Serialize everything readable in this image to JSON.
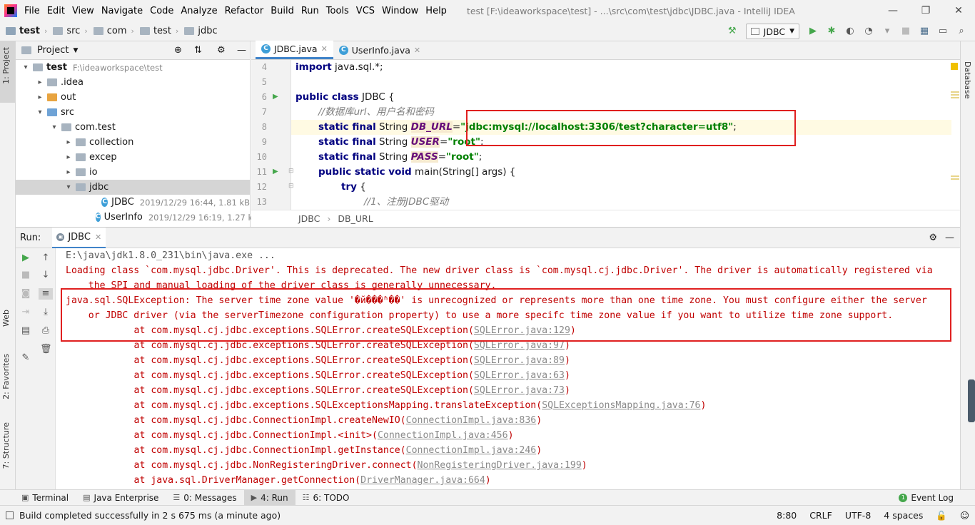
{
  "window": {
    "title": "test [F:\\ideaworkspace\\test] - ...\\src\\com\\test\\jdbc\\JDBC.java - IntelliJ IDEA",
    "menu": [
      "File",
      "Edit",
      "View",
      "Navigate",
      "Code",
      "Analyze",
      "Refactor",
      "Build",
      "Run",
      "Tools",
      "VCS",
      "Window",
      "Help"
    ]
  },
  "breadcrumb": [
    "test",
    "src",
    "com",
    "test",
    "jdbc"
  ],
  "toolbar": {
    "run_config": "JDBC"
  },
  "left_tool_tabs": [
    "1: Project",
    "Web",
    "2: Favorites",
    "7: Structure"
  ],
  "right_tool_tabs": [
    "Database"
  ],
  "project": {
    "header": "Project",
    "tree": [
      {
        "label": "test",
        "meta": "F:\\ideaworkspace\\test",
        "depth": 0,
        "arrow": "▾",
        "bold": true
      },
      {
        "label": ".idea",
        "meta": "",
        "depth": 1,
        "arrow": "▸"
      },
      {
        "label": "out",
        "meta": "",
        "depth": 1,
        "arrow": "▸"
      },
      {
        "label": "src",
        "meta": "",
        "depth": 1,
        "arrow": "▾"
      },
      {
        "label": "com.test",
        "meta": "",
        "depth": 2,
        "arrow": "▾"
      },
      {
        "label": "collection",
        "meta": "",
        "depth": 3,
        "arrow": "▸"
      },
      {
        "label": "excep",
        "meta": "",
        "depth": 3,
        "arrow": "▸"
      },
      {
        "label": "io",
        "meta": "",
        "depth": 3,
        "arrow": "▸"
      },
      {
        "label": "jdbc",
        "meta": "",
        "depth": 3,
        "arrow": "▾",
        "selected": true
      },
      {
        "label": "JDBC",
        "meta": "2019/12/29 16:44, 1.81 kB",
        "depth": 5,
        "arrow": "",
        "cls": true
      },
      {
        "label": "UserInfo",
        "meta": "2019/12/29 16:19, 1.27 kB",
        "depth": 5,
        "arrow": "",
        "cls": true
      }
    ]
  },
  "editor": {
    "tabs": [
      {
        "label": "JDBC.java",
        "active": true
      },
      {
        "label": "UserInfo.java",
        "active": false
      }
    ],
    "line_numbers": [
      "4",
      "5",
      "6",
      "7",
      "8",
      "9",
      "10",
      "11",
      "12",
      "13"
    ],
    "code": {
      "l4_kw": "import",
      "l4_rest": " java.sql.*;",
      "l6_kw": "public class",
      "l6_rest": " JDBC {",
      "l7_comment": "//数据库url、用户名和密码",
      "l8_kw": "static final",
      "l8_type": " String ",
      "l8_field": "DB_URL",
      "l8_eq": "=",
      "l8_str": "\"jdbc:mysql://localhost:3306/test?character=utf8\"",
      "l8_end": ";",
      "l9_kw": "static final",
      "l9_type": " String ",
      "l9_field": "USER",
      "l9_eq": "=",
      "l9_str": "\"root\"",
      "l9_end": ";",
      "l10_kw": "static final",
      "l10_type": " String ",
      "l10_field": "PASS",
      "l10_eq": "=",
      "l10_str": "\"root\"",
      "l10_end": ";",
      "l11_kw": "public static void",
      "l11_rest": " main(String[] args) {",
      "l12_kw": "try",
      "l12_rest": " {",
      "l13_comment": "//1、注册JDBC驱动"
    },
    "crumb": [
      "JDBC",
      "DB_URL"
    ]
  },
  "run": {
    "label": "Run:",
    "tab": "JDBC",
    "console": {
      "cmd": "E:\\java\\jdk1.8.0_231\\bin\\java.exe ...",
      "warn1": "Loading class `com.mysql.jdbc.Driver'. This is deprecated. The new driver class is `com.mysql.cj.jdbc.Driver'. The driver is automatically registered via",
      "warn2": "    the SPI and manual loading of the driver class is generally unnecessary.",
      "err1": "java.sql.SQLException: The server time zone value '�й���ʱ��' is unrecognized or represents more than one time zone. You must configure either the server",
      "err2": "    or JDBC driver (via the serverTimezone configuration property) to use a more specifc time zone value if you want to utilize time zone support.",
      "stack": [
        {
          "text": "\tat com.mysql.cj.jdbc.exceptions.SQLError.createSQLException(",
          "link": "SQLError.java:129"
        },
        {
          "text": "\tat com.mysql.cj.jdbc.exceptions.SQLError.createSQLException(",
          "link": "SQLError.java:97"
        },
        {
          "text": "\tat com.mysql.cj.jdbc.exceptions.SQLError.createSQLException(",
          "link": "SQLError.java:89"
        },
        {
          "text": "\tat com.mysql.cj.jdbc.exceptions.SQLError.createSQLException(",
          "link": "SQLError.java:63"
        },
        {
          "text": "\tat com.mysql.cj.jdbc.exceptions.SQLError.createSQLException(",
          "link": "SQLError.java:73"
        },
        {
          "text": "\tat com.mysql.cj.jdbc.exceptions.SQLExceptionsMapping.translateException(",
          "link": "SQLExceptionsMapping.java:76"
        },
        {
          "text": "\tat com.mysql.cj.jdbc.ConnectionImpl.createNewIO(",
          "link": "ConnectionImpl.java:836"
        },
        {
          "text": "\tat com.mysql.cj.jdbc.ConnectionImpl.<init>(",
          "link": "ConnectionImpl.java:456"
        },
        {
          "text": "\tat com.mysql.cj.jdbc.ConnectionImpl.getInstance(",
          "link": "ConnectionImpl.java:246"
        },
        {
          "text": "\tat com.mysql.cj.jdbc.NonRegisteringDriver.connect(",
          "link": "NonRegisteringDriver.java:199"
        },
        {
          "text": "\tat java.sql.DriverManager.getConnection(",
          "link": "DriverManager.java:664"
        }
      ]
    }
  },
  "bottom_tabs": [
    {
      "label": "Terminal",
      "icon": "terminal-icon",
      "glyph": "▣"
    },
    {
      "label": "Java Enterprise",
      "icon": "java-enterprise-icon",
      "glyph": "▤"
    },
    {
      "label": "0: Messages",
      "icon": "messages-icon",
      "glyph": "☰"
    },
    {
      "label": "4: Run",
      "icon": "run-icon",
      "glyph": "▶",
      "active": true
    },
    {
      "label": "6: TODO",
      "icon": "todo-icon",
      "glyph": "☷"
    }
  ],
  "event_log": "Event Log",
  "status": {
    "message": "Build completed successfully in 2 s 675 ms (a minute ago)",
    "position": "8:80",
    "line_sep": "CRLF",
    "encoding": "UTF-8",
    "indent": "4 spaces"
  },
  "colors": {
    "accent": "#4083c9",
    "error": "#c00000",
    "annotation": "#e02020",
    "run_green": "#45a74c"
  }
}
